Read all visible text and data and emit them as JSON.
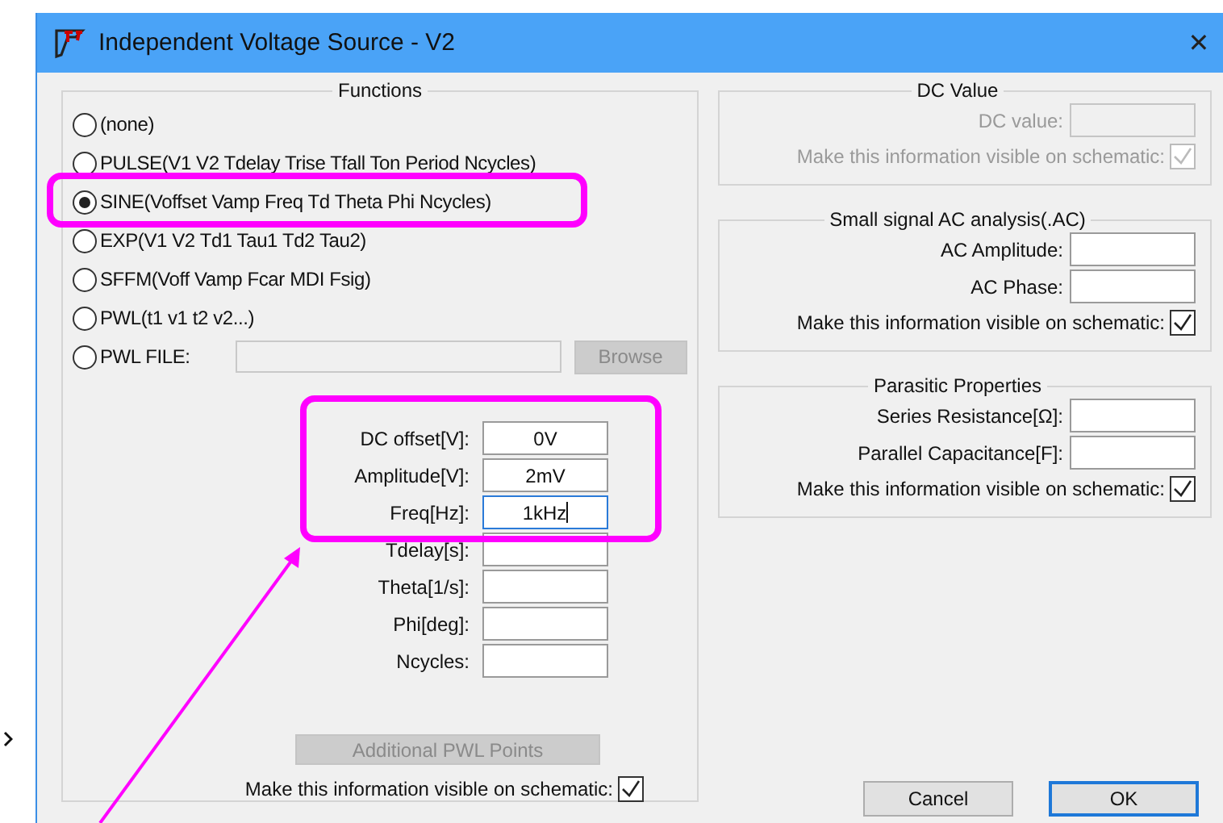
{
  "window": {
    "title": "Independent Voltage Source - V2",
    "close": "✕"
  },
  "functions": {
    "title": "Functions",
    "options": [
      {
        "kind": "plain",
        "label": "(none)",
        "selected": false
      },
      {
        "kind": "plain",
        "label": "PULSE(V1 V2 Tdelay Trise Tfall Ton Period Ncycles)",
        "selected": false
      },
      {
        "kind": "plain",
        "label": "SINE(Voffset Vamp Freq Td Theta Phi Ncycles)",
        "selected": true
      },
      {
        "kind": "plain",
        "label": "EXP(V1 V2 Td1 Tau1 Td2 Tau2)",
        "selected": false
      },
      {
        "kind": "plain",
        "label": "SFFM(Voff Vamp Fcar MDI Fsig)",
        "selected": false
      },
      {
        "kind": "plain",
        "label": "PWL(t1 v1 t2 v2...)",
        "selected": false
      },
      {
        "kind": "file",
        "label": "PWL FILE:",
        "selected": false,
        "button": "Browse",
        "disabled": true
      }
    ],
    "parameters": [
      {
        "label": "DC offset[V]:",
        "value": "0V",
        "focused": false
      },
      {
        "label": "Amplitude[V]:",
        "value": "2mV",
        "focused": false
      },
      {
        "label": "Freq[Hz]:",
        "value": "1kHz",
        "focused": true
      },
      {
        "label": "Tdelay[s]:",
        "focused": false
      },
      {
        "label": "Theta[1/s]:",
        "focused": false
      },
      {
        "label": "Phi[deg]:",
        "focused": false
      },
      {
        "label": "Ncycles:",
        "focused": false
      }
    ],
    "pwl_points_button": {
      "label": "Additional PWL Points",
      "disabled": true
    },
    "visible_on_schematic": {
      "label": "Make this information visible on schematic:",
      "checked": true
    }
  },
  "right_groups": [
    {
      "title": "DC Value",
      "disabled": true,
      "fields": [
        {
          "label": "DC value:"
        }
      ],
      "visible_on_schematic": {
        "label": "Make this information visible on schematic:",
        "checked": true
      }
    },
    {
      "title": "Small signal AC analysis(.AC)",
      "disabled": false,
      "fields": [
        {
          "label": "AC Amplitude:"
        },
        {
          "label": "AC Phase:"
        }
      ],
      "visible_on_schematic": {
        "label": "Make this information visible on schematic:",
        "checked": true
      }
    },
    {
      "title": "Parasitic Properties",
      "disabled": false,
      "fields": [
        {
          "label": "Series Resistance[Ω]:"
        },
        {
          "label": "Parallel Capacitance[F]:"
        }
      ],
      "visible_on_schematic": {
        "label": "Make this information visible on schematic:",
        "checked": true
      }
    }
  ],
  "buttons": [
    {
      "label": "Cancel",
      "default": false
    },
    {
      "label": "OK",
      "default": true
    }
  ]
}
